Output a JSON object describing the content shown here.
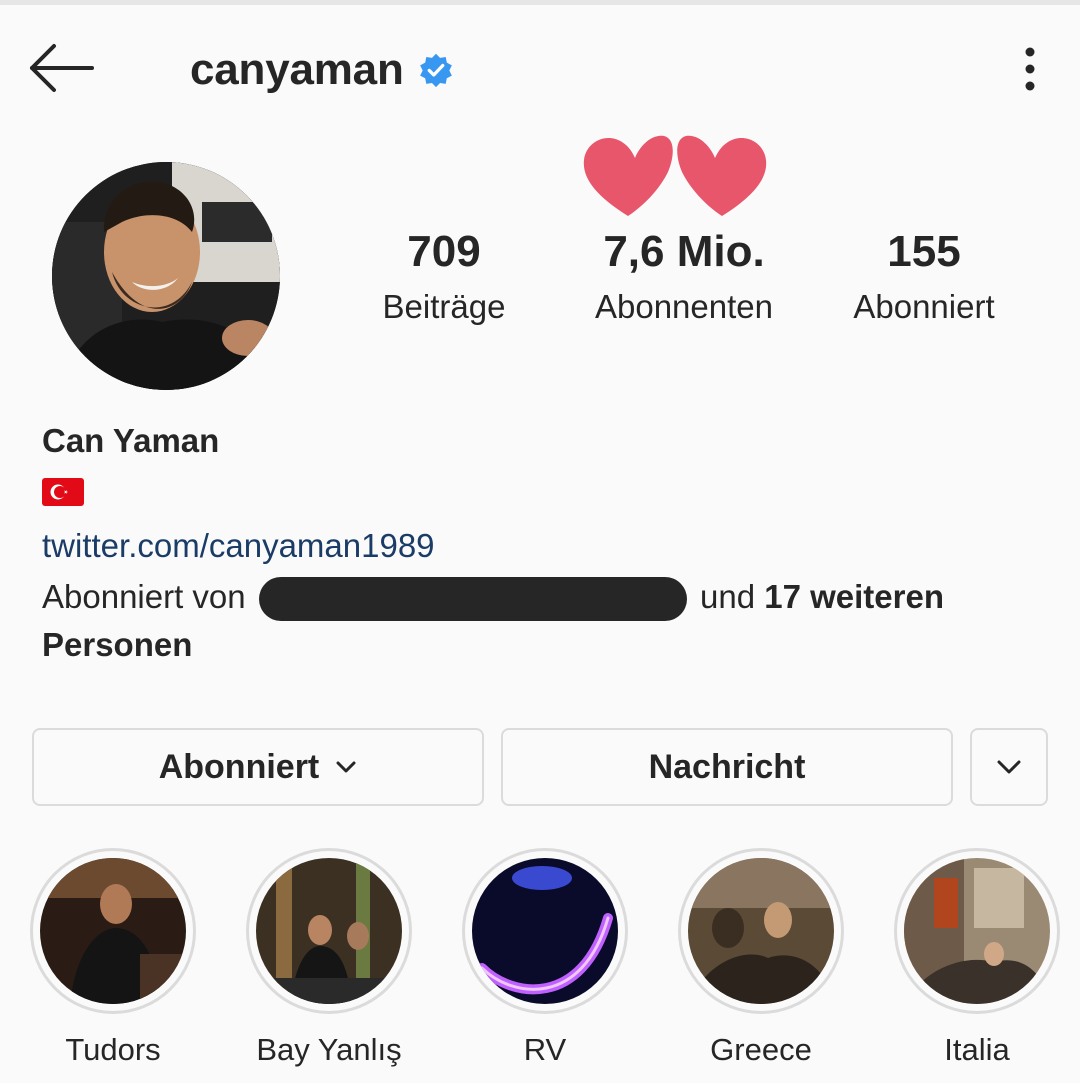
{
  "header": {
    "username": "canyaman",
    "verified": true
  },
  "profile": {
    "stats": [
      {
        "value": "709",
        "label": "Beiträge"
      },
      {
        "value": "7,6 Mio.",
        "label": "Abonnenten"
      },
      {
        "value": "155",
        "label": "Abonniert"
      }
    ],
    "full_name": "Can Yaman",
    "flag_emoji": "🇹🇷",
    "link": "twitter.com/canyaman1989",
    "followed_by_prefix": "Abonniert von",
    "followed_by_middle": "und",
    "followed_by_bold": "17 weiteren Personen"
  },
  "buttons": {
    "following": "Abonniert",
    "message": "Nachricht"
  },
  "highlights": [
    {
      "label": "Tudors"
    },
    {
      "label": "Bay Yanlış"
    },
    {
      "label": "RV"
    },
    {
      "label": "Greece"
    },
    {
      "label": "Italia"
    }
  ],
  "colors": {
    "verified": "#3897f0",
    "hearts": "#e8566c",
    "link": "#1a3c66",
    "border": "#dbdbdb"
  }
}
